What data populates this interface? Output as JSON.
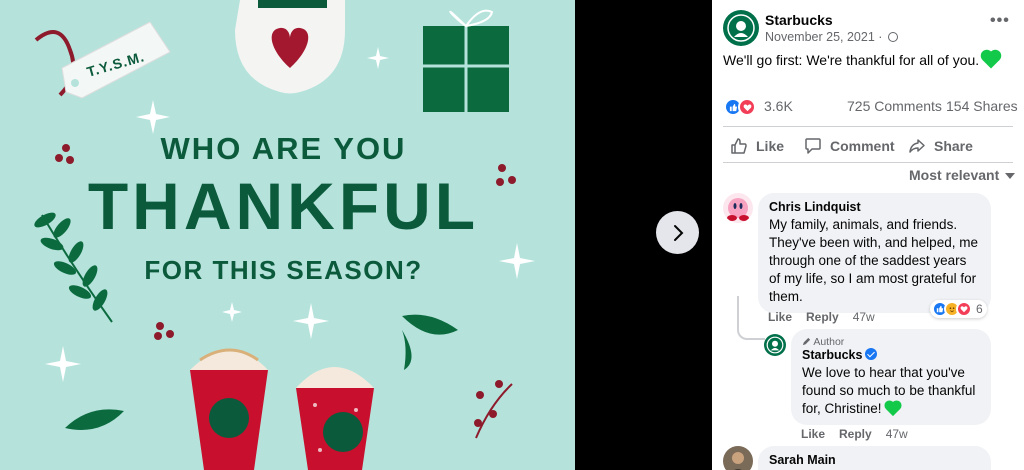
{
  "image": {
    "gift_tag_text": "T.Y.S.M.",
    "headline_line1": "WHO ARE YOU",
    "headline_line2": "THANKFUL",
    "headline_line3": "FOR THIS SEASON?",
    "background_color": "#b5e3dc",
    "brand_green": "#0b5a3b"
  },
  "viewer": {
    "next_icon": "chevron-right-icon"
  },
  "post": {
    "page_name": "Starbucks",
    "date": "November 25, 2021 ·",
    "privacy_icon": "globe-icon",
    "caption": "We'll go first: We're thankful for all of you.",
    "caption_emoji": "green-heart",
    "reaction_count": "3.6K",
    "comments": "725 Comments",
    "shares": "154 Shares",
    "actions": {
      "like": "Like",
      "comment": "Comment",
      "share": "Share"
    },
    "sort_label": "Most relevant"
  },
  "comments": [
    {
      "author": "Chris Lindquist",
      "text": "My family, animals, and friends. They've been with, and helped, me through one of the saddest years of my life, so I am most grateful for them.",
      "reaction_count": "6",
      "like": "Like",
      "reply": "Reply",
      "age": "47w"
    },
    {
      "badge": "Author",
      "author": "Starbucks",
      "text": "We love to hear that you've found so much to be thankful for, Christine!",
      "like": "Like",
      "reply": "Reply",
      "age": "47w"
    },
    {
      "author": "Sarah Main"
    }
  ],
  "colors": {
    "facebook_blue": "#1877f2",
    "secondary_text": "#65676b",
    "bubble_bg": "#f0f2f5"
  }
}
